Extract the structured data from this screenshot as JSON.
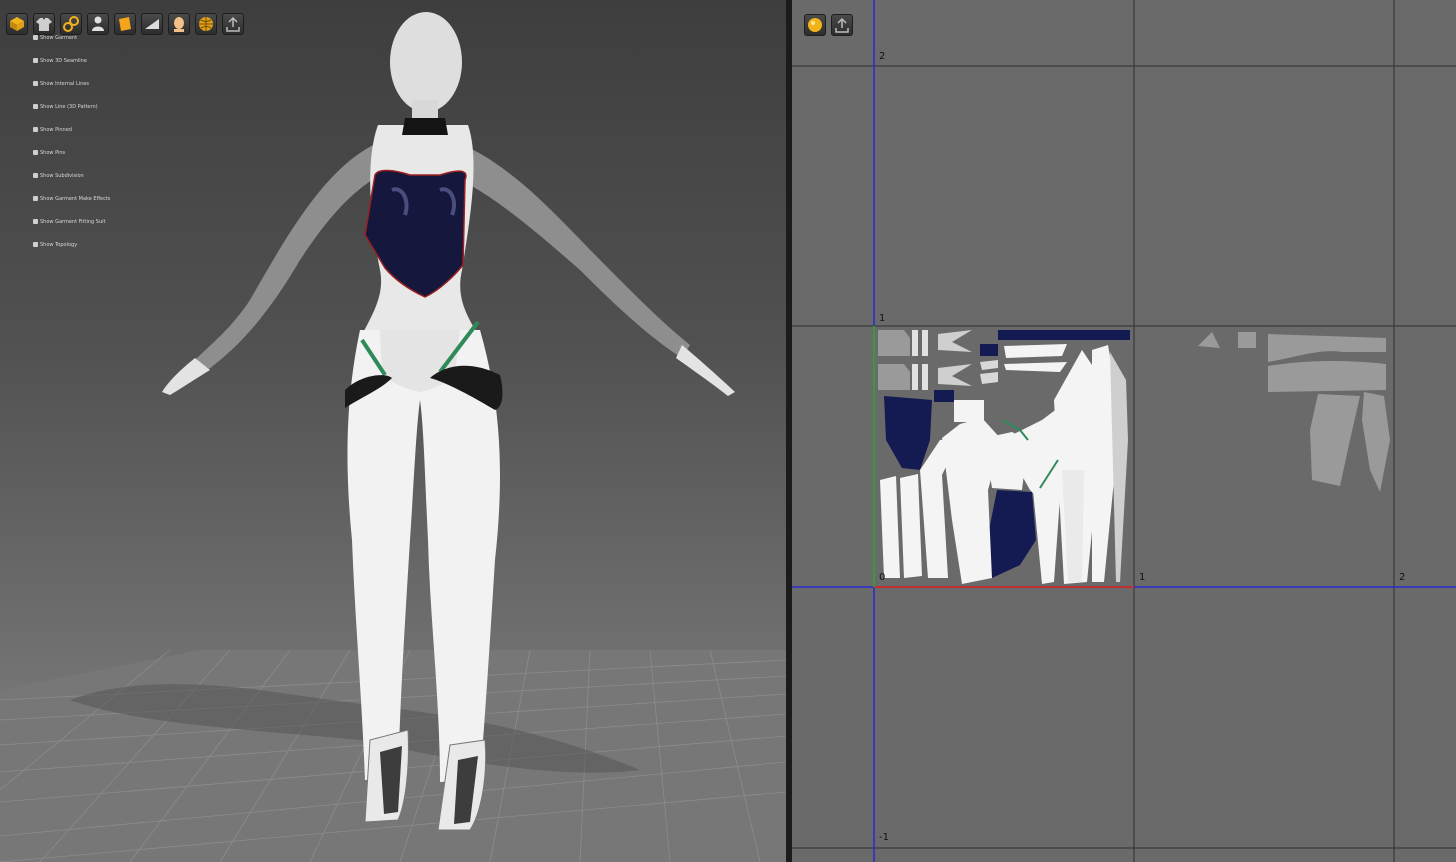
{
  "viewport3d": {
    "toolbar_icons": [
      "garment-cube-icon",
      "shirt-icon",
      "gears-icon",
      "avatar-icon",
      "fabric-icon",
      "layer-icon",
      "face-icon",
      "globe-mesh-icon",
      "export-icon"
    ],
    "menu": [
      {
        "label": "Show Garment",
        "icon": "shirt-icon"
      },
      {
        "label": "Show 3D Seamline",
        "icon": "seam-icon"
      },
      {
        "label": "Show Internal Lines",
        "icon": "lines-icon"
      },
      {
        "label": "Show Line (3D Pattern)",
        "icon": "pattern-icon"
      },
      {
        "label": "Show Pinned",
        "icon": "pin-icon"
      },
      {
        "label": "Show Pins",
        "icon": "pins-icon"
      },
      {
        "label": "Show Subdivision",
        "icon": "subdivision-icon"
      },
      {
        "label": "Show Garment Make Effects",
        "icon": "effects-icon"
      },
      {
        "label": "Show Garment Fitting Suit",
        "icon": "fitting-icon"
      },
      {
        "label": "Show Topology",
        "icon": "topology-icon"
      }
    ]
  },
  "uvview": {
    "toolbar_icons": [
      "sphere-icon",
      "export-icon"
    ],
    "axis_labels": {
      "y2": "2",
      "y1": "1",
      "origin": "0",
      "x1": "1",
      "x2": "2",
      "ym1": "-1"
    }
  },
  "colors": {
    "navy_fabric": "#141a52",
    "white_fabric": "#f4f4f4",
    "gray_fabric": "#9a9a9a",
    "uv_axis": "#2b2bd0",
    "uv_u_axis": "#c03030",
    "uv_v_axis": "#3a9a3a",
    "trim_green": "#2f8a5a"
  }
}
